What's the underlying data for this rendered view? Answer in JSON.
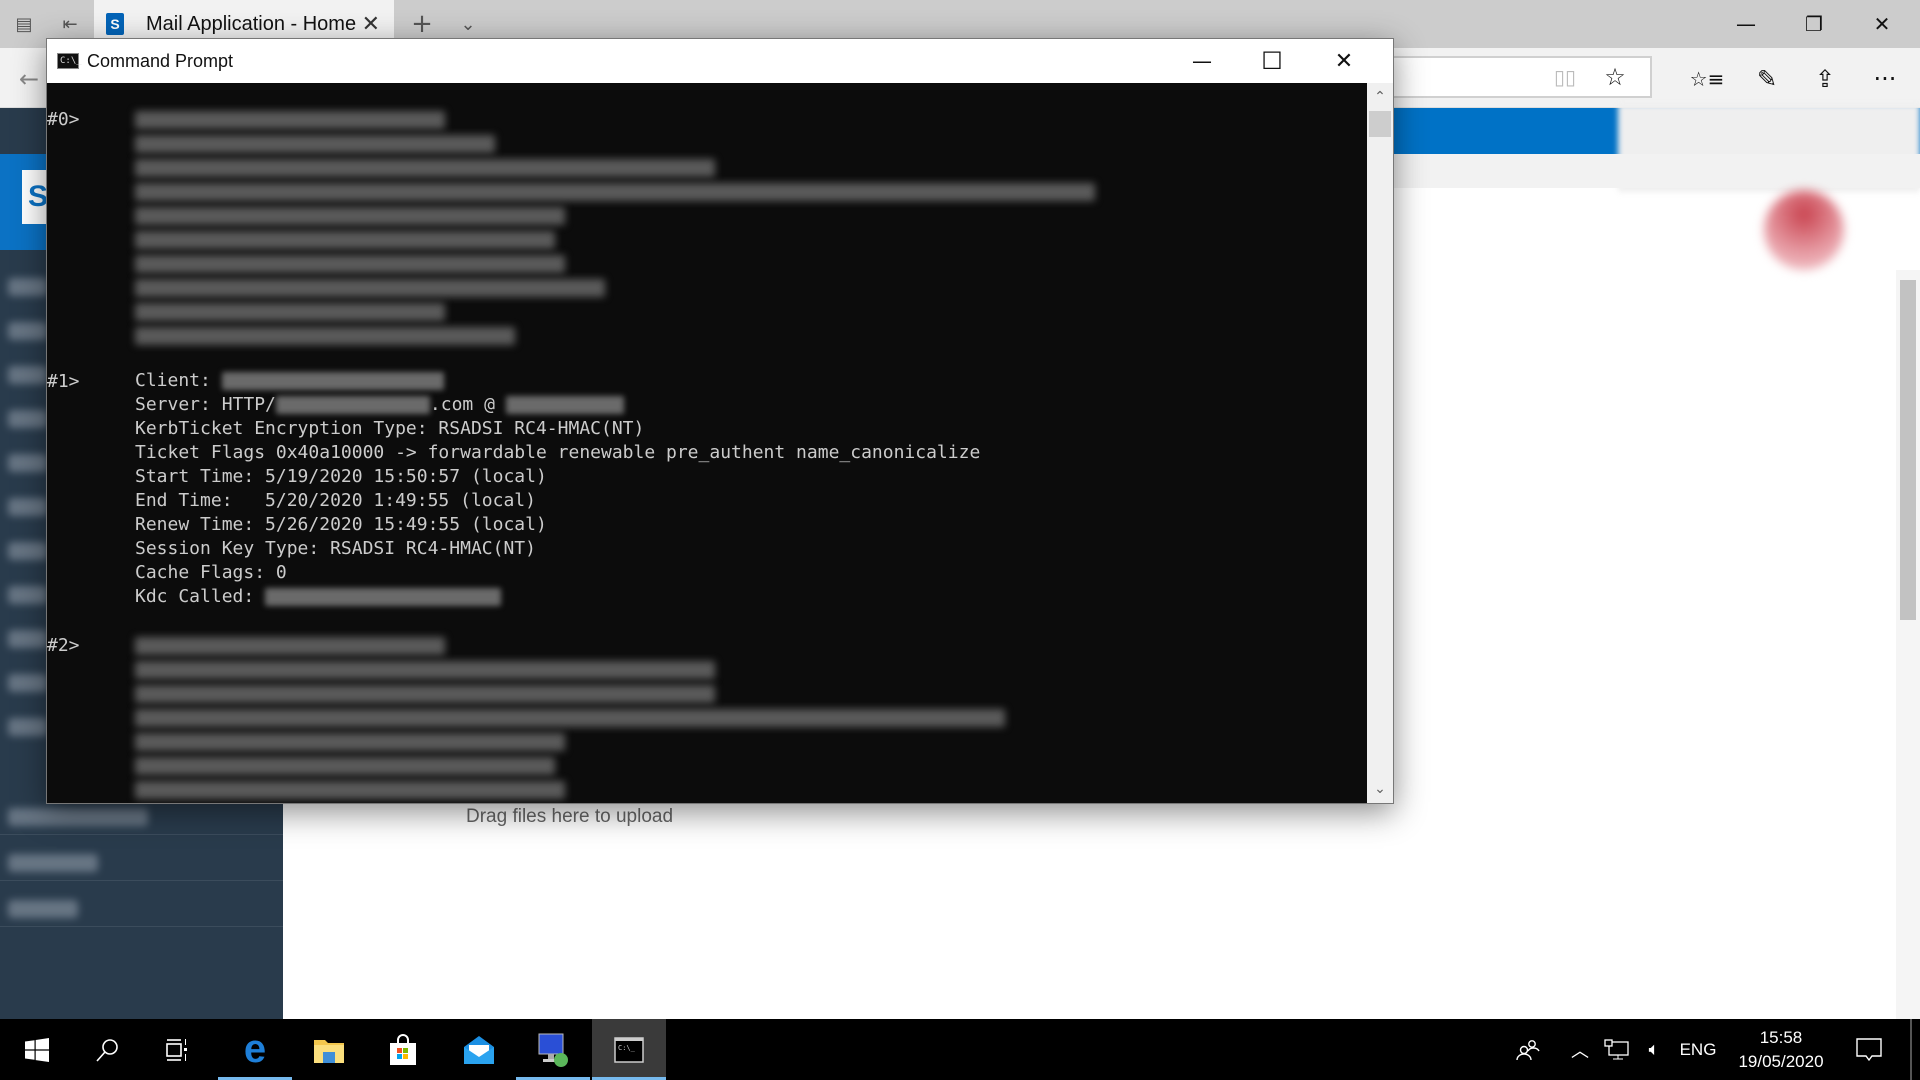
{
  "browser": {
    "tab_title": "Mail Application - Home",
    "tab_close": "✕",
    "new_tab": "+",
    "tab_list": "⌄",
    "window_controls": {
      "minimize": "—",
      "restore": "❐",
      "close": "✕"
    },
    "nav": {
      "back": "←"
    },
    "toolbar_icons": {
      "reading_view": "📖",
      "favorite": "☆",
      "favorites_hub": "☆≡",
      "notes": "✎",
      "share": "⇪",
      "more": "···"
    }
  },
  "sharepoint": {
    "logo_letter": "S",
    "upload_hint": "Drag files here to upload"
  },
  "cmd": {
    "title": "Command Prompt",
    "icon_text": "C:\\_",
    "controls": {
      "minimize": "—",
      "maximize": "☐",
      "close": "✕"
    },
    "scroll_up": "⌃",
    "scroll_down": "⌄",
    "tickets": [
      {
        "label": "#0>",
        "redacted": true
      },
      {
        "label": "#1>",
        "redacted": false,
        "lines": {
          "client_label": "Client: ",
          "server_prefix": "Server: HTTP/",
          "server_mid": ".com @ ",
          "encryption": "KerbTicket Encryption Type: RSADSI RC4-HMAC(NT)",
          "flags": "Ticket Flags 0x40a10000 -> forwardable renewable pre_authent name_canonicalize",
          "start": "Start Time: 5/19/2020 15:50:57 (local)",
          "end": "End Time:   5/20/2020 1:49:55 (local)",
          "renew": "Renew Time: 5/26/2020 15:49:55 (local)",
          "session_key": "Session Key Type: RSADSI RC4-HMAC(NT)",
          "cache_flags": "Cache Flags: 0",
          "kdc_label": "Kdc Called: "
        }
      },
      {
        "label": "#2>",
        "redacted": true
      }
    ]
  },
  "taskbar": {
    "items": [
      "Start",
      "Search",
      "Task View",
      "Microsoft Edge",
      "File Explorer",
      "Microsoft Store",
      "Mail",
      "Remote Desktop Connection",
      "Command Prompt"
    ],
    "tray": {
      "language": "ENG",
      "time": "15:58",
      "date": "19/05/2020"
    }
  }
}
